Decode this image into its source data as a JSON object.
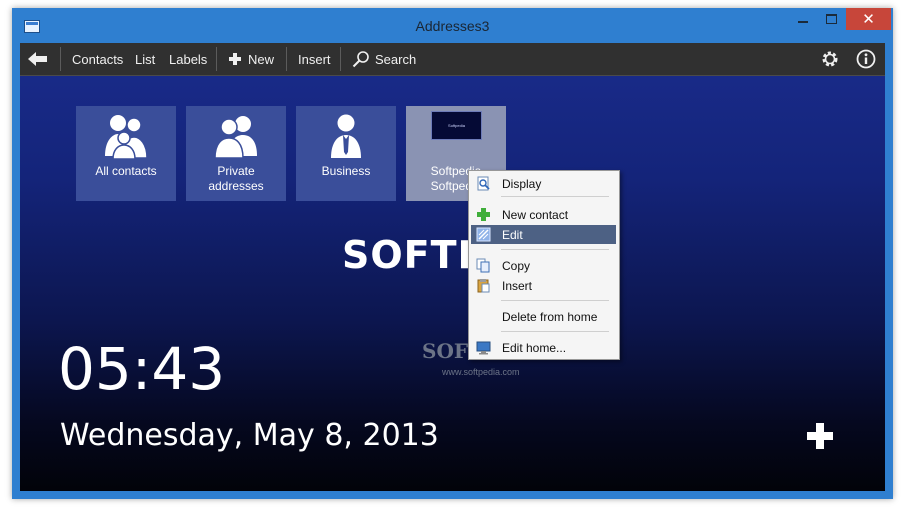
{
  "window": {
    "title": "Addresses3",
    "close_glyph": "✕"
  },
  "toolbar": {
    "contacts": "Contacts",
    "list": "List",
    "labels": "Labels",
    "new": "New",
    "insert": "Insert",
    "search": "Search"
  },
  "tiles": [
    {
      "label_1": "All contacts",
      "label_2": ""
    },
    {
      "label_1": "Private",
      "label_2": "addresses"
    },
    {
      "label_1": "Business",
      "label_2": ""
    },
    {
      "label_1": "Softpedia",
      "label_2": "Softpedia",
      "thumb_text": "Softpedia"
    }
  ],
  "watermark": {
    "large": "SOFTP",
    "small": "SOFTP",
    "url": "www.softpedia.com"
  },
  "clock": {
    "time": "05:43",
    "date": "Wednesday, May 8, 2013"
  },
  "context_menu": {
    "display": "Display",
    "new_contact": "New contact",
    "edit": "Edit",
    "copy": "Copy",
    "insert": "Insert",
    "delete_from_home": "Delete from home",
    "edit_home": "Edit home..."
  },
  "colors": {
    "accent": "#2f7fd0",
    "toolbar_bg": "#303030",
    "tile_bg": "#3a4e9a",
    "highlight": "#4d6184",
    "close_button": "#c7463a"
  },
  "icons": [
    "back-arrow-icon",
    "plus-icon",
    "search-icon",
    "gear-icon",
    "info-icon",
    "people-icon",
    "couple-icon",
    "businessman-icon",
    "add-icon"
  ]
}
